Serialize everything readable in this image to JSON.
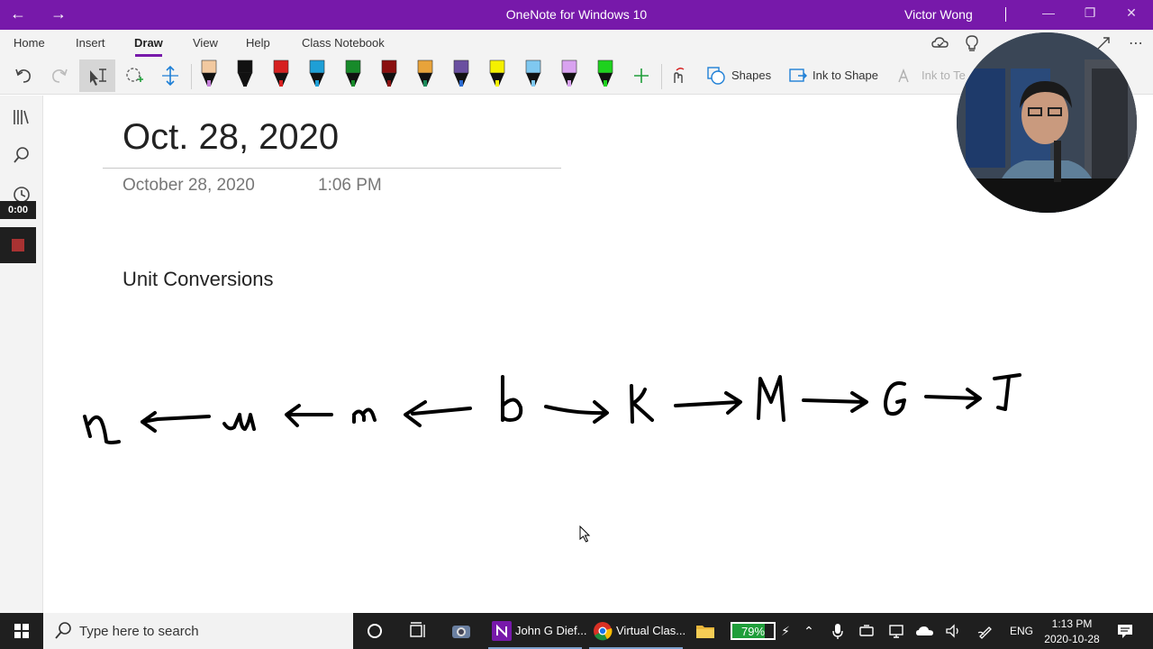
{
  "titlebar": {
    "back_icon": "back-arrow-icon",
    "forward_icon": "forward-arrow-icon",
    "app_title": "OneNote for Windows 10",
    "user_name": "Victor Wong"
  },
  "ribbon": {
    "tabs": [
      "Home",
      "Insert",
      "Draw",
      "View",
      "Help",
      "Class Notebook"
    ],
    "active_tab": "Draw"
  },
  "toolbar": {
    "shapes_label": "Shapes",
    "ink_to_shape_label": "Ink to Shape",
    "ink_to_text_label": "Ink to Te",
    "pens": [
      {
        "color": "#f2c9a0",
        "tip": "#c47fd9"
      },
      {
        "color": "#111111",
        "tip": "#111111"
      },
      {
        "color": "#d62020",
        "tip": "#d62020"
      },
      {
        "color": "#1e9fd6",
        "tip": "#1e9fd6"
      },
      {
        "color": "#178a2a",
        "tip": "#178a2a"
      },
      {
        "color": "#8a1010",
        "tip": "#8a1010"
      },
      {
        "color": "#e8a33a",
        "tip": "#1a8a5a"
      },
      {
        "color": "#6a4fa0",
        "tip": "#2a6ad0"
      },
      {
        "color": "#f5f000",
        "tip": "#f5f000"
      },
      {
        "color": "#7fc8f0",
        "tip": "#7fc8f0"
      },
      {
        "color": "#d9a3f0",
        "tip": "#d9a3f0"
      },
      {
        "color": "#1ed21e",
        "tip": "#1ed21e"
      }
    ]
  },
  "leftnav": {
    "timer": "0:00"
  },
  "page": {
    "title": "Oct. 28, 2020",
    "date": "October 28, 2020",
    "time": "1:06 PM",
    "heading": "Unit Conversions",
    "ink_letters": [
      "n",
      "u",
      "m",
      "b",
      "k",
      "M",
      "G",
      "T"
    ]
  },
  "taskbar": {
    "search_placeholder": "Type here to search",
    "apps": [
      {
        "label": "John G Dief...",
        "icon": "onenote-icon"
      },
      {
        "label": "Virtual Clas...",
        "icon": "chrome-icon"
      }
    ],
    "battery_percent": "79%",
    "battery_level": 0.79,
    "language": "ENG",
    "clock_time": "1:13 PM",
    "clock_date": "2020-10-28"
  }
}
